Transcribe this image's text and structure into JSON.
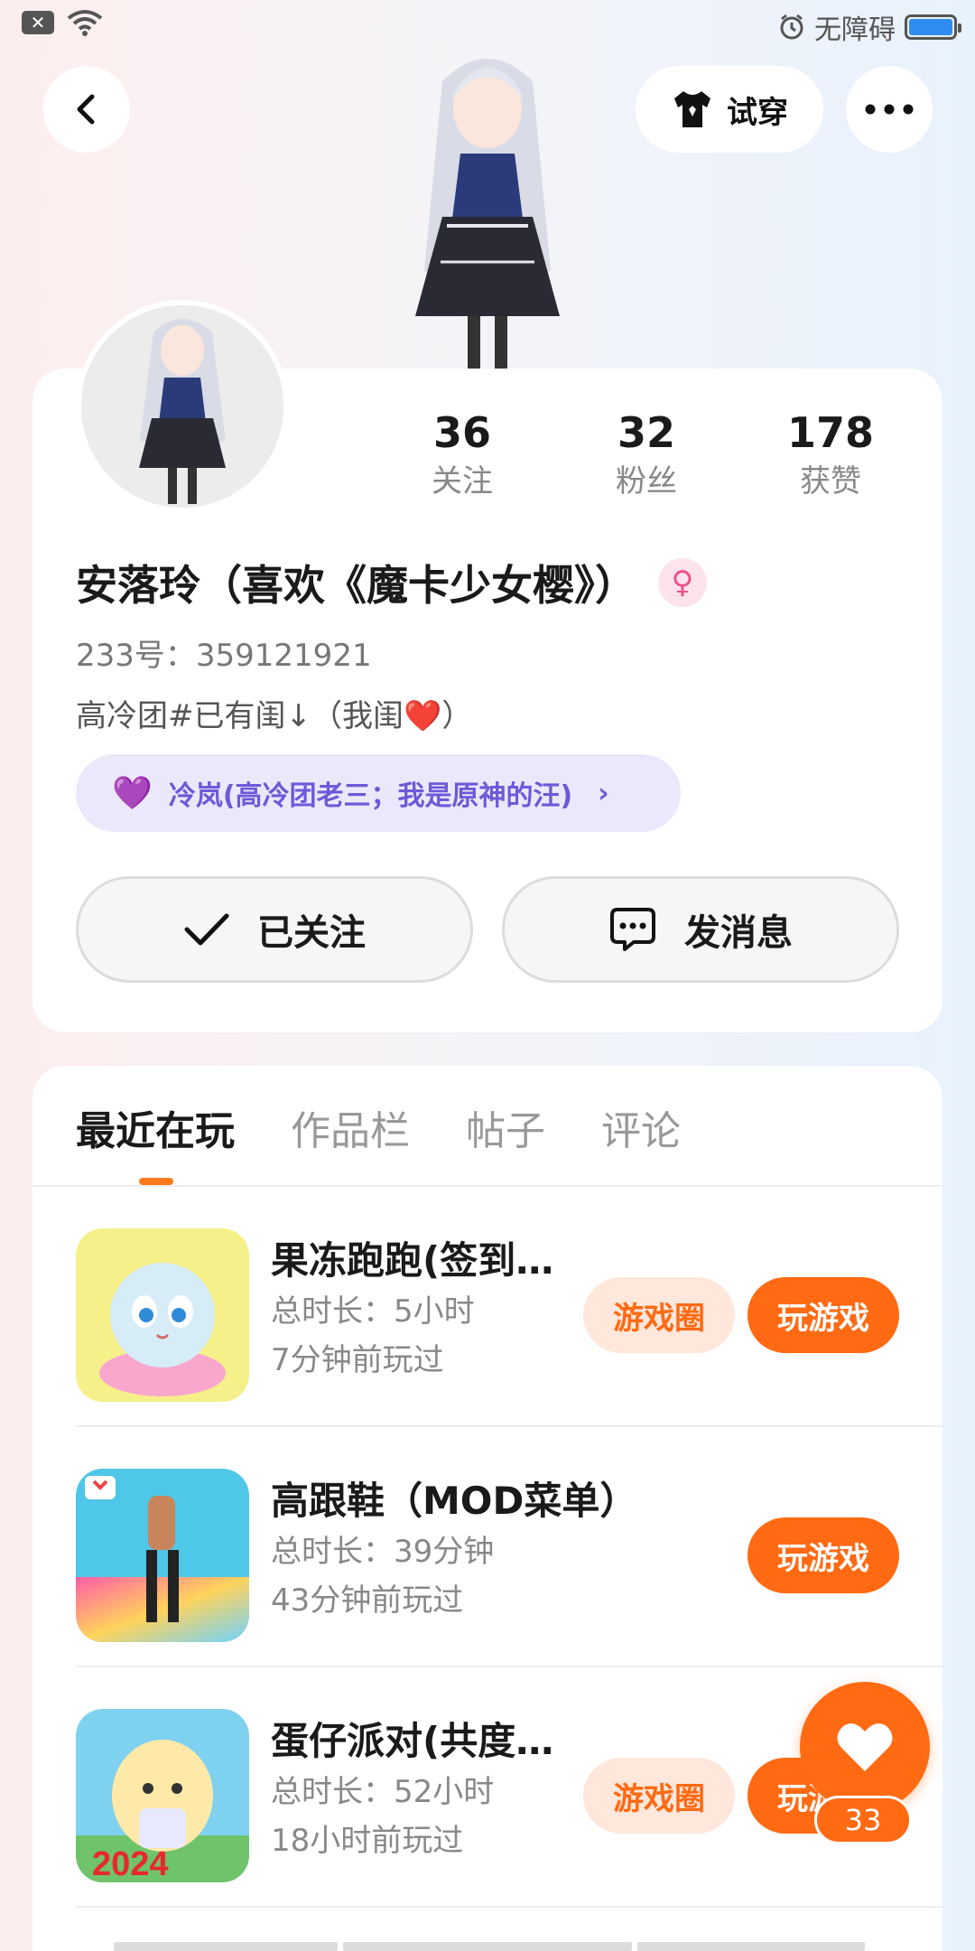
{
  "status_bar": {
    "accessibility": "无障碍"
  },
  "header": {
    "try_on_label": "试穿"
  },
  "profile": {
    "stats": [
      {
        "num": "36",
        "label": "关注"
      },
      {
        "num": "32",
        "label": "粉丝"
      },
      {
        "num": "178",
        "label": "获赞"
      }
    ],
    "name": "安落玲（喜欢《魔卡少女樱》）",
    "uid": "233号：359121921",
    "bio_text": "高冷团#已有闺↓（我闺",
    "bio_heart": "❤️",
    "bio_end": "）",
    "partner": "冷岚(高冷团老三；我是原神的汪)",
    "follow_label": "已关注",
    "message_label": "发消息"
  },
  "tabs": [
    {
      "label": "最近在玩"
    },
    {
      "label": "作品栏"
    },
    {
      "label": "帖子"
    },
    {
      "label": "评论"
    }
  ],
  "games": [
    {
      "title": "果冻跑跑(签到…",
      "time": "总时长：5小时",
      "last": "7分钟前玩过",
      "circle": "游戏圈",
      "play": "玩游戏"
    },
    {
      "title": "高跟鞋（MOD菜单）",
      "time": "总时长：39分钟",
      "last": "43分钟前玩过",
      "circle": "",
      "play": "玩游戏"
    },
    {
      "title": "蛋仔派对(共度…",
      "time": "总时长：52小时",
      "last": "18小时前玩过",
      "circle": "游戏圈",
      "play": "玩游戏"
    }
  ],
  "game3_badge": "2024",
  "like_count": "33",
  "colors": {
    "accent": "#ff6a13",
    "accent_soft": "#ffe7dc",
    "partner_bg": "#ece8fb",
    "partner_text": "#6c5ad8"
  }
}
